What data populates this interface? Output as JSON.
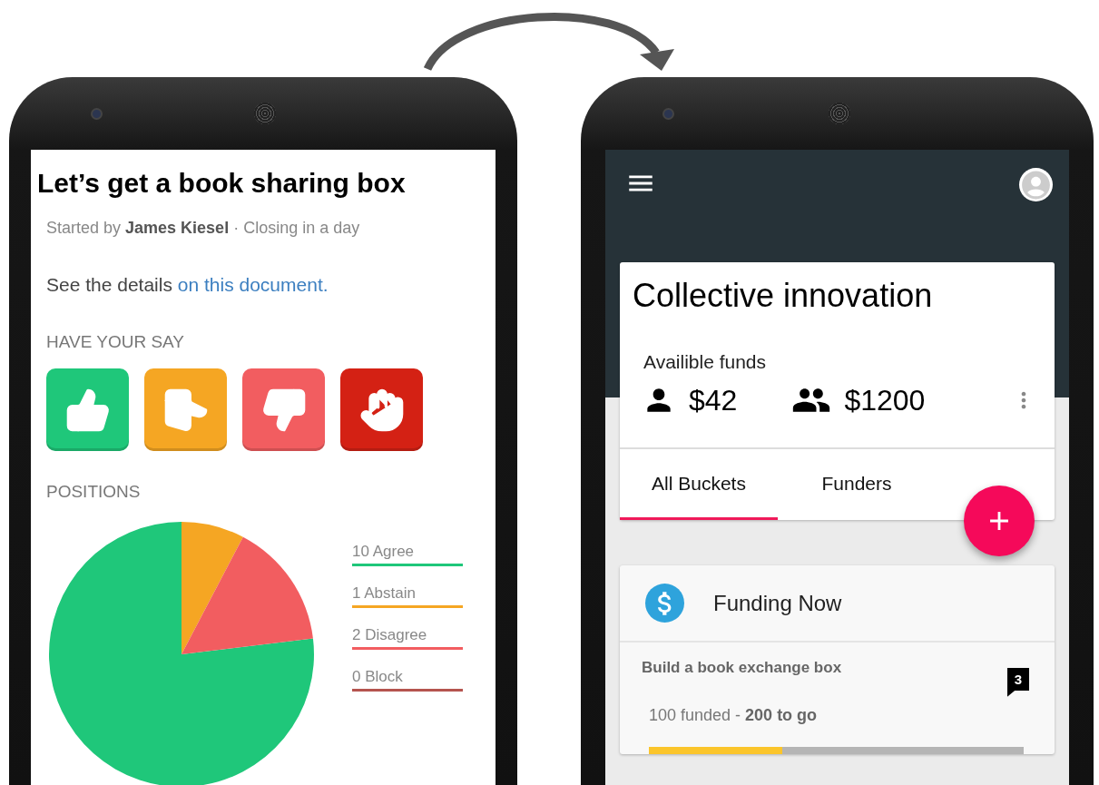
{
  "left_screen": {
    "title": "Let’s get a book sharing box",
    "byline": "Started by **James Kiesel** · Closing in a day",
    "details": {
      "text": "See the details",
      "link": "on this document."
    },
    "vote_heading": "HAVE YOUR SAY",
    "vote_buttons": [
      {
        "kind": "agree",
        "color": "#1fc77a"
      },
      {
        "kind": "abstain",
        "color": "#f5a623"
      },
      {
        "kind": "disagree",
        "color": "#f25d60"
      },
      {
        "kind": "block",
        "color": "#d42114"
      }
    ],
    "positions_heading": "POSITIONS",
    "legend": [
      {
        "color": "#1fc77a"
      },
      {
        "color": "#f5a623"
      },
      {
        "color": "#f25d60"
      },
      {
        "color": "#b5544f"
      }
    ],
    "chart_data": {
      "type": "pie",
      "categories": [
        "10 Agree",
        "1 Abstain",
        "2 Disagree",
        "0 Block"
      ],
      "series": [
        {
          "values": [
            10,
            1,
            2,
            0
          ]
        }
      ]
    }
  },
  "right_screen": {
    "group_title": "Collective innovation",
    "funds_label": "Availible funds",
    "funds": [
      {
        "kind": "person",
        "amount": "$42"
      },
      {
        "kind": "group",
        "amount": "$1200"
      }
    ],
    "tabs": [
      {
        "label": "All Buckets",
        "selected": true
      },
      {
        "label": "Funders",
        "selected": false
      }
    ],
    "section_title": "Funding Now",
    "bucket": {
      "title": "Build a book exchange box",
      "comments": "3",
      "progress_text": "100 funded - **200 to go**",
      "level": 0.355
    }
  }
}
